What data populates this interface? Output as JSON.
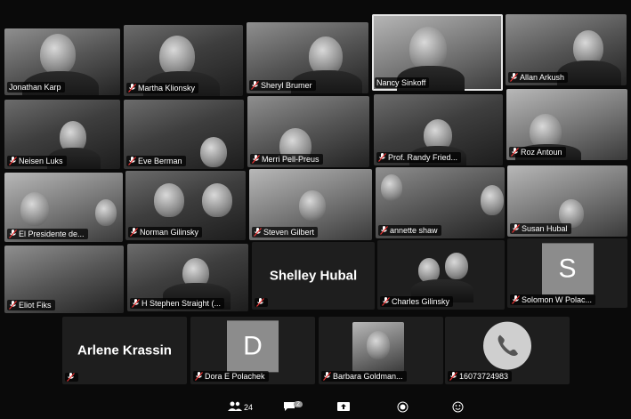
{
  "participants": [
    {
      "name": "Jonathan Karp",
      "muted": false
    },
    {
      "name": "Martha Klionsky",
      "muted": true
    },
    {
      "name": "Sheryl Brumer",
      "muted": true
    },
    {
      "name": "Nancy Sinkoff",
      "muted": false
    },
    {
      "name": "Allan Arkush",
      "muted": true
    },
    {
      "name": "Neisen Luks",
      "muted": true
    },
    {
      "name": "Eve Berman",
      "muted": true
    },
    {
      "name": "Merri Pell-Preus",
      "muted": true
    },
    {
      "name": "Prof. Randy Fried...",
      "muted": true
    },
    {
      "name": "Roz Antoun",
      "muted": true
    },
    {
      "name": "El Presidente de...",
      "muted": true
    },
    {
      "name": "Norman Gilinsky",
      "muted": true
    },
    {
      "name": "Steven Gilbert",
      "muted": true
    },
    {
      "name": "annette shaw",
      "muted": true
    },
    {
      "name": "Susan Hubal",
      "muted": true
    },
    {
      "name": "Eliot Fiks",
      "muted": true
    },
    {
      "name": "H Stephen Straight (...",
      "muted": true
    },
    {
      "name": "",
      "display_name": "Shelley Hubal",
      "muted": true
    },
    {
      "name": "Charles Gilinsky",
      "muted": true
    },
    {
      "name": "Solomon W Polac...",
      "avatar_letter": "S",
      "muted": true
    },
    {
      "name": "",
      "display_name": "Arlene Krassin",
      "muted": true
    },
    {
      "name": "Dora E Polachek",
      "avatar_letter": "D",
      "muted": true
    },
    {
      "name": "Barbara Goldman...",
      "muted": true
    },
    {
      "name": "16073724983",
      "phone": true,
      "muted": true
    }
  ],
  "toolbar": {
    "participants_count": "24",
    "chat_badge": "2"
  },
  "colors": {
    "background": "#0a0a0a",
    "tile_dark": "#1e1e1e",
    "avatar": "#8c8c8c",
    "active_border": "#e6e6e6"
  }
}
